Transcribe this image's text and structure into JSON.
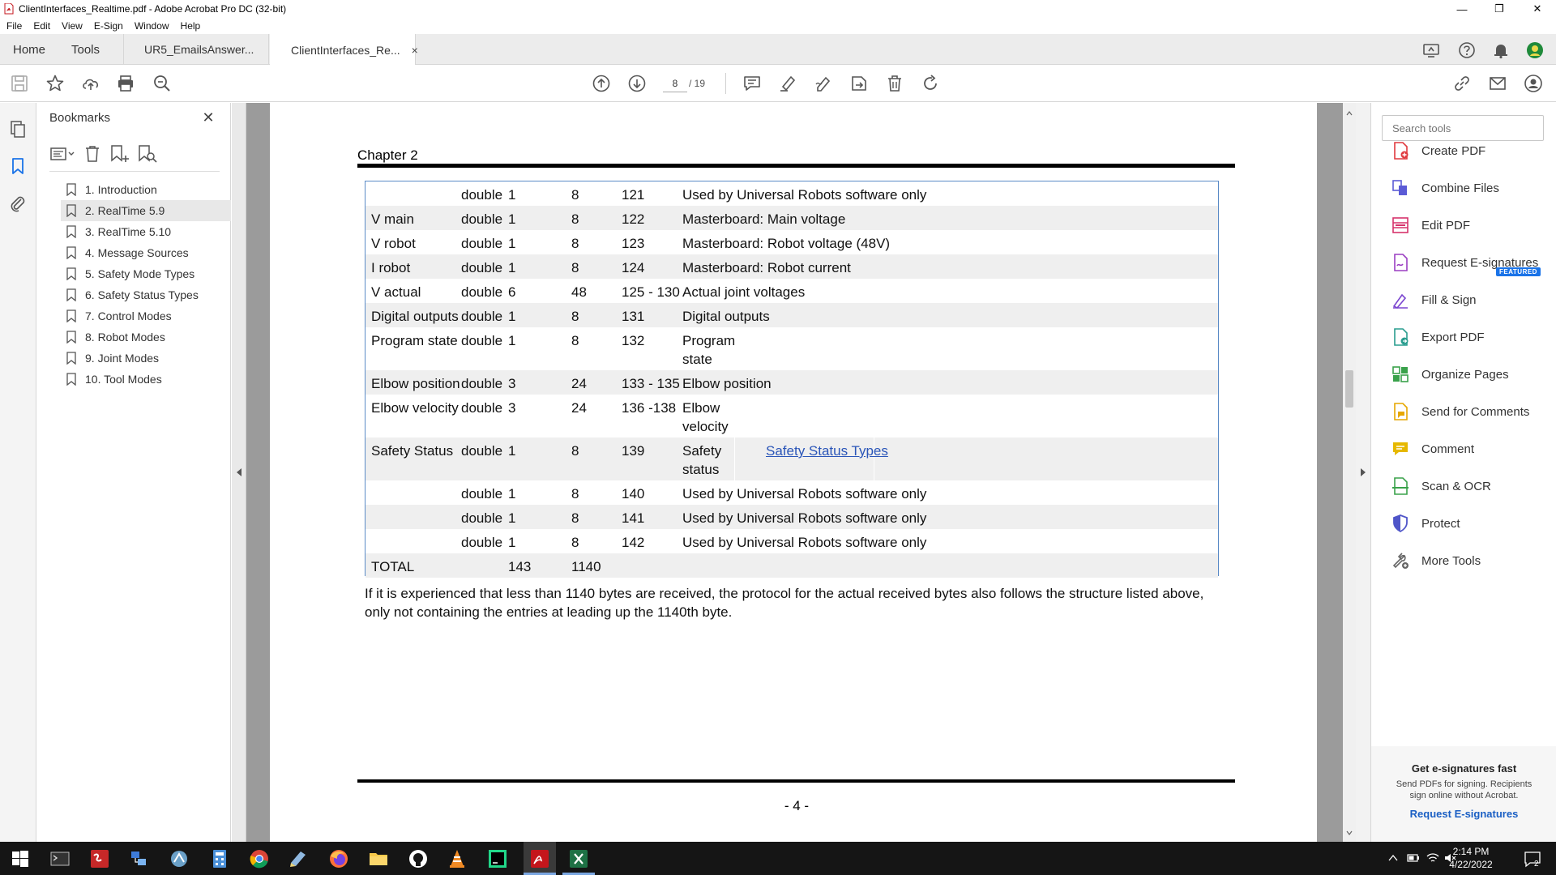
{
  "window": {
    "title": "ClientInterfaces_Realtime.pdf - Adobe Acrobat Pro DC (32-bit)",
    "controls": [
      "—",
      "❐",
      "✕"
    ]
  },
  "menubar": [
    "File",
    "Edit",
    "View",
    "E-Sign",
    "Window",
    "Help"
  ],
  "tabs": {
    "home": "Home",
    "tools": "Tools",
    "docs": [
      {
        "label": "UR5_EmailsAnswer..."
      },
      {
        "label": "ClientInterfaces_Re...",
        "close": "×"
      }
    ]
  },
  "toolbar": {
    "page_current": "8",
    "page_total": "/ 19"
  },
  "bookmarks": {
    "title": "Bookmarks",
    "close": "✕",
    "items": [
      {
        "label": "1. Introduction"
      },
      {
        "label": "2. RealTime 5.9"
      },
      {
        "label": "3. RealTime 5.10"
      },
      {
        "label": "4. Message Sources"
      },
      {
        "label": "5. Safety Mode Types"
      },
      {
        "label": "6. Safety Status Types"
      },
      {
        "label": "7. Control Modes"
      },
      {
        "label": "8. Robot Modes"
      },
      {
        "label": "9. Joint Modes"
      },
      {
        "label": "10. Tool Modes"
      }
    ],
    "selected_index": 1
  },
  "document": {
    "chapter": "Chapter 2",
    "rows": [
      {
        "name": "",
        "type": "double",
        "count": "1",
        "bytes": "8",
        "index": "121",
        "desc": [
          "Used by Universal Robots software only"
        ]
      },
      {
        "name": "V main",
        "type": "double",
        "count": "1",
        "bytes": "8",
        "index": "122",
        "desc": [
          "Masterboard: Main voltage"
        ]
      },
      {
        "name": "V robot",
        "type": "double",
        "count": "1",
        "bytes": "8",
        "index": "123",
        "desc": [
          "Masterboard: Robot voltage (48V)"
        ]
      },
      {
        "name": "I robot",
        "type": "double",
        "count": "1",
        "bytes": "8",
        "index": "124",
        "desc": [
          "Masterboard: Robot current"
        ]
      },
      {
        "name": "V actual",
        "type": "double",
        "count": "6",
        "bytes": "48",
        "index": "125 - 130",
        "desc": [
          "Actual joint voltages"
        ]
      },
      {
        "name": "Digital outputs",
        "type": "double",
        "count": "1",
        "bytes": "8",
        "index": "131",
        "desc": [
          "Digital outputs"
        ]
      },
      {
        "name": "Program state",
        "type": "double",
        "count": "1",
        "bytes": "8",
        "index": "132",
        "desc": [
          "Program",
          "state"
        ]
      },
      {
        "name": "Elbow position",
        "type": "double",
        "count": "3",
        "bytes": "24",
        "index": "133 - 135",
        "desc": [
          "Elbow position"
        ]
      },
      {
        "name": "Elbow velocity",
        "type": "double",
        "count": "3",
        "bytes": "24",
        "index": "136 -138",
        "desc": [
          "Elbow",
          "velocity"
        ]
      },
      {
        "name": "Safety Status",
        "type": "double",
        "count": "1",
        "bytes": "8",
        "index": "139",
        "desc": [
          "Safety",
          "status"
        ],
        "link": "Safety Status Types"
      },
      {
        "name": "",
        "type": "double",
        "count": "1",
        "bytes": "8",
        "index": "140",
        "desc": [
          "Used by Universal Robots software only"
        ]
      },
      {
        "name": "",
        "type": "double",
        "count": "1",
        "bytes": "8",
        "index": "141",
        "desc": [
          "Used by Universal Robots software only"
        ]
      },
      {
        "name": "",
        "type": "double",
        "count": "1",
        "bytes": "8",
        "index": "142",
        "desc": [
          "Used by Universal Robots software only"
        ]
      },
      {
        "name": "TOTAL",
        "type": "",
        "count": "143",
        "bytes": "1140",
        "index": "",
        "desc": [
          ""
        ]
      }
    ],
    "note": "If it is experienced that less than 1140 bytes are received, the protocol for the actual received bytes also follows the structure listed above, only not containing the entries at leading up the 1140th byte.",
    "page_number": "- 4 -"
  },
  "tools_pane": {
    "search_placeholder": "Search tools",
    "featured_badge": "FEATURED",
    "items": [
      {
        "label": "Create PDF",
        "icon": "create-pdf-icon",
        "color": "#e0393e"
      },
      {
        "label": "Combine Files",
        "icon": "combine-files-icon",
        "color": "#5b5bd6"
      },
      {
        "label": "Edit PDF",
        "icon": "edit-pdf-icon",
        "color": "#d6336c"
      },
      {
        "label": "Request E-signatures",
        "icon": "request-esign-icon",
        "color": "#9b3fc2"
      },
      {
        "label": "Fill & Sign",
        "icon": "fill-sign-icon",
        "color": "#7b46d0"
      },
      {
        "label": "Export PDF",
        "icon": "export-pdf-icon",
        "color": "#2a9d8f"
      },
      {
        "label": "Organize Pages",
        "icon": "organize-pages-icon",
        "color": "#3aa24b"
      },
      {
        "label": "Send for Comments",
        "icon": "send-comments-icon",
        "color": "#e6a700"
      },
      {
        "label": "Comment",
        "icon": "comment-icon",
        "color": "#e6b800"
      },
      {
        "label": "Scan & OCR",
        "icon": "scan-ocr-icon",
        "color": "#3aa24b"
      },
      {
        "label": "Protect",
        "icon": "protect-icon",
        "color": "#4f55c9"
      },
      {
        "label": "More Tools",
        "icon": "more-tools-icon",
        "color": "#666666"
      }
    ],
    "promo": {
      "title": "Get e-signatures fast",
      "text": "Send PDFs for signing. Recipients sign online without Acrobat.",
      "link": "Request E-signatures"
    }
  },
  "taskbar": {
    "time": "2:14 PM",
    "date": "4/22/2022",
    "notifications": "2"
  },
  "colors": {
    "accent": "#1a73e8",
    "table_border": "#5a8ac6",
    "link": "#2a55b8",
    "doc_background": "#9b9b9b"
  }
}
